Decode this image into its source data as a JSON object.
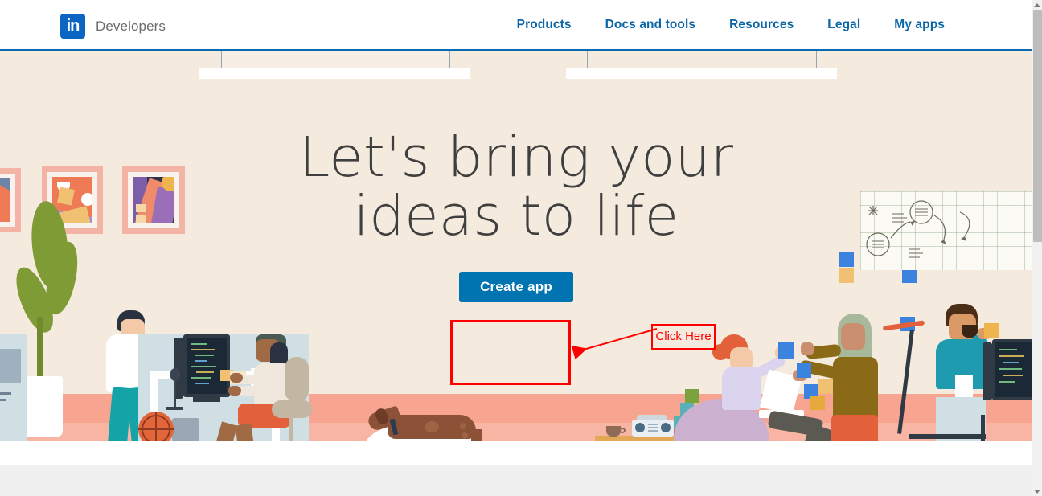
{
  "header": {
    "logo_icon": "linkedin-logo-icon",
    "logo_text": "in",
    "brand_name": "Developers",
    "nav_items": [
      {
        "label": "Products"
      },
      {
        "label": "Docs and tools"
      },
      {
        "label": "Resources"
      },
      {
        "label": "Legal"
      },
      {
        "label": "My apps"
      }
    ],
    "accent_color": "#0b66a8",
    "underline_color": "#0c69b0"
  },
  "hero": {
    "headline_line1": "Let's bring your",
    "headline_line2": "ideas to life",
    "cta_label": "Create app",
    "background_color": "#f5eade",
    "cta_color": "#0073b1",
    "headline_color": "#3f3f3f"
  },
  "annotation": {
    "label": "Click Here",
    "color": "#ff0000",
    "target": "create-app-button"
  },
  "illustration": {
    "alt": "office scene with developers, artwork frames, plant, dog, whiteboard and scooter",
    "floor_color": "#f7a491",
    "wall_color": "#f5eade"
  },
  "scrollbar": {
    "up_icon": "scroll-up-arrow-icon",
    "down_icon": "scroll-down-arrow-icon",
    "thumb_color": "#bdbdbd"
  }
}
